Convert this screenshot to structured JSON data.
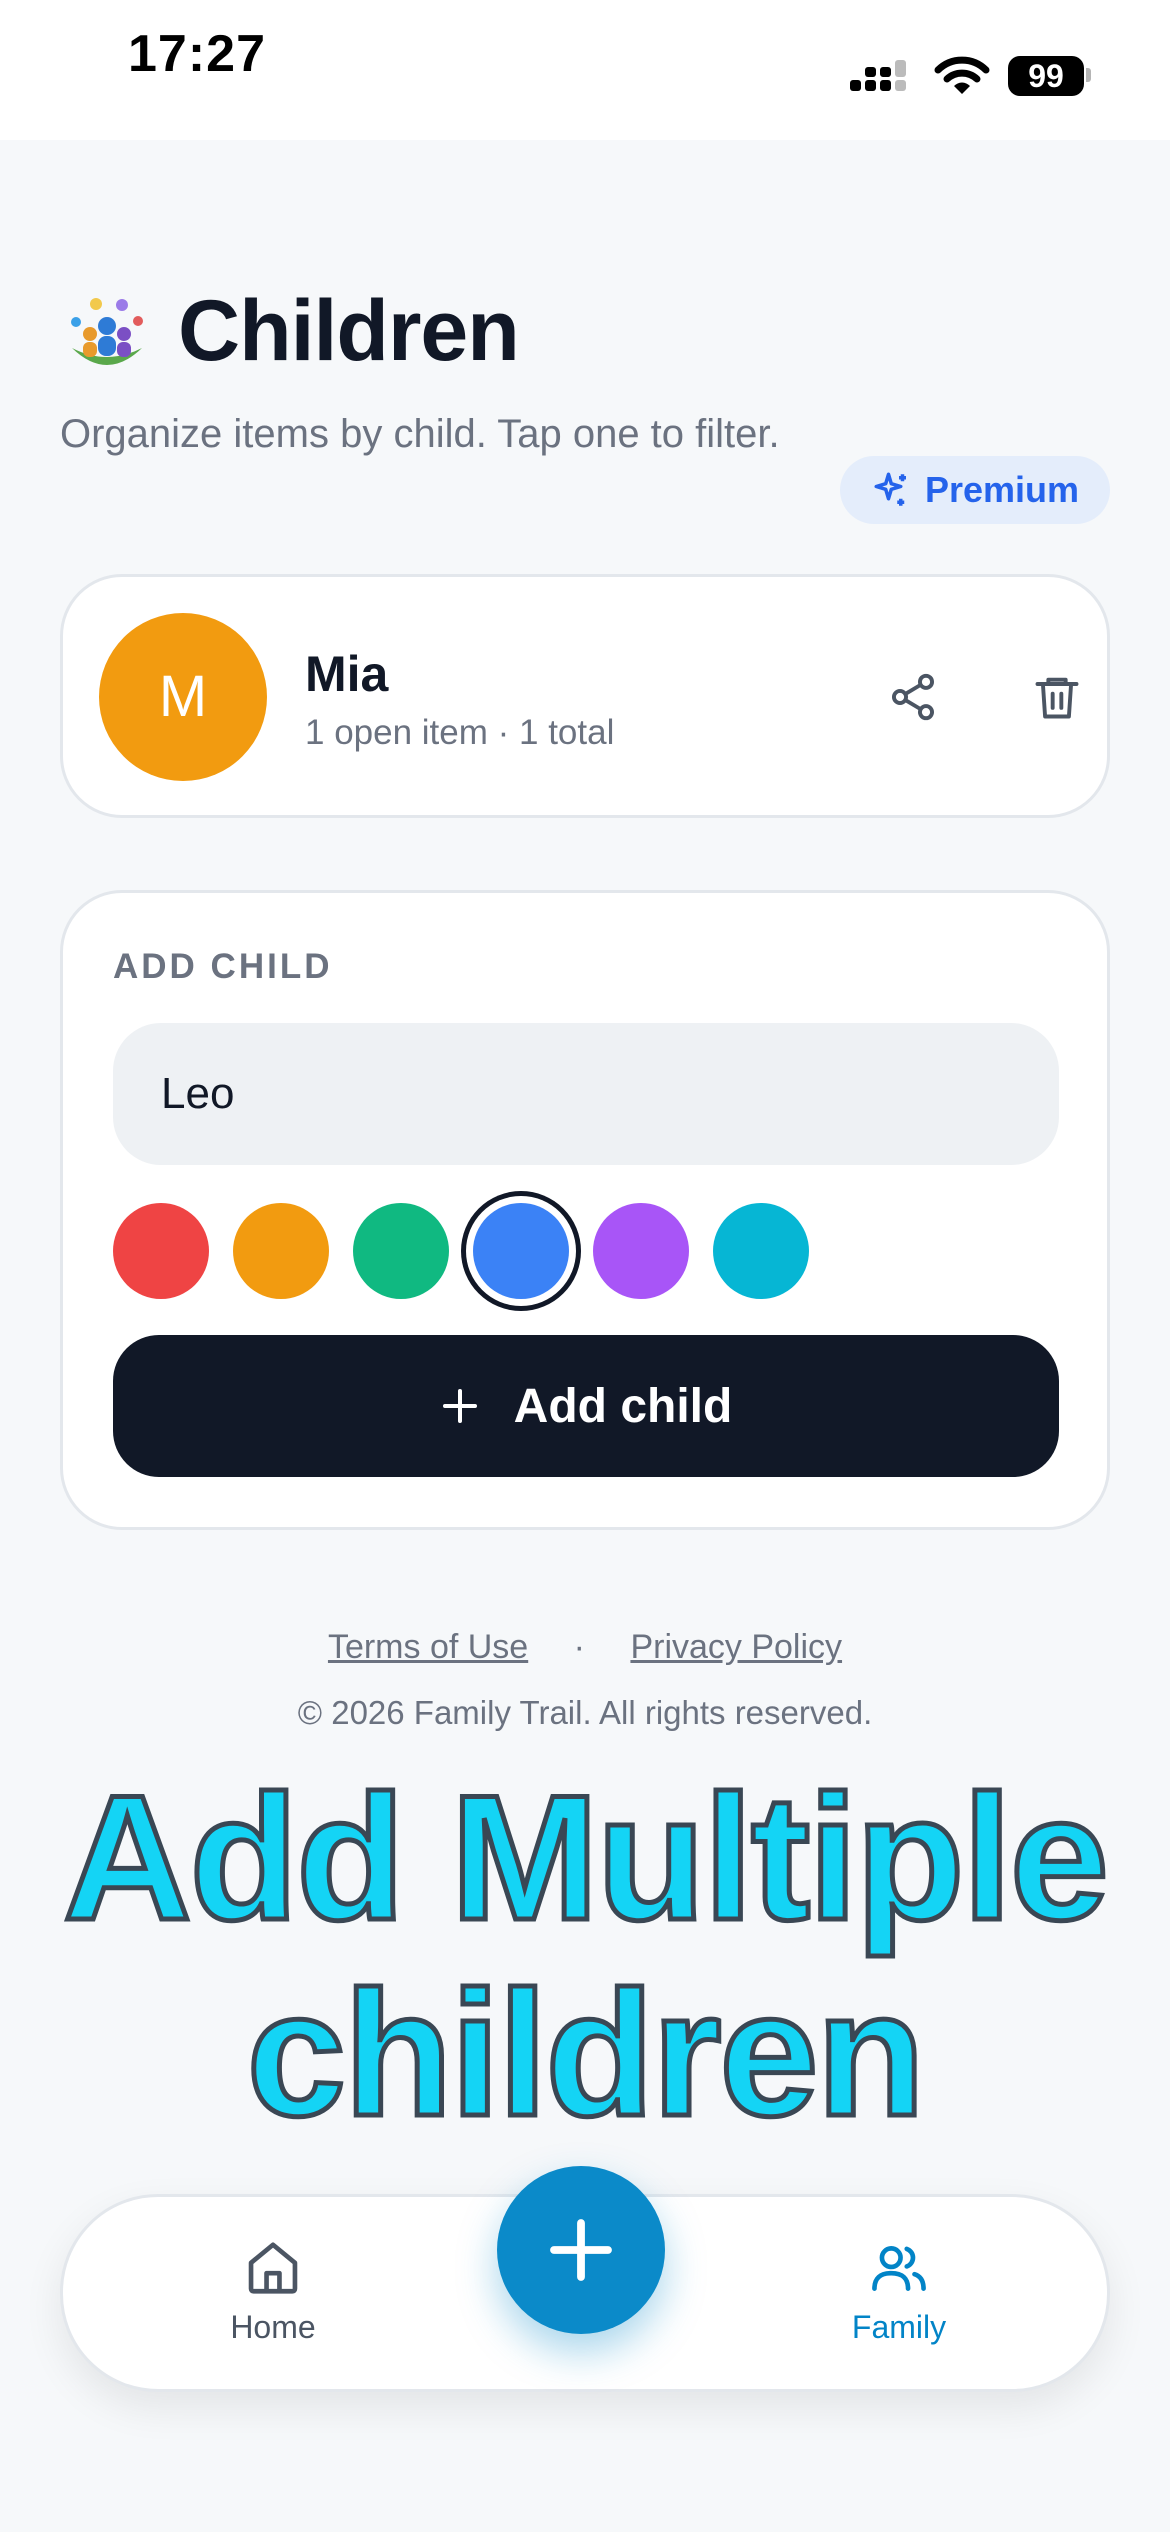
{
  "status_bar": {
    "time": "17:27",
    "battery": "99"
  },
  "header": {
    "title": "Children",
    "subtitle": "Organize items by child. Tap one to filter.",
    "premium_label": "Premium"
  },
  "children": [
    {
      "initial": "M",
      "name": "Mia",
      "meta": "1 open item · 1 total",
      "color": "#f29b10"
    }
  ],
  "add_child": {
    "section_label": "ADD CHILD",
    "name_value": "Leo",
    "colors": [
      "#ef4444",
      "#f29b10",
      "#10b981",
      "#3b82f6",
      "#a855f7",
      "#06b6d4"
    ],
    "selected_color": "#3b82f6",
    "button_label": "Add child"
  },
  "footer": {
    "terms": "Terms of Use",
    "separator": "·",
    "privacy": "Privacy Policy",
    "copyright": "© 2026 Family Trail. All rights reserved."
  },
  "promo": {
    "line1": "Add Multiple",
    "line2": "children"
  },
  "tabbar": {
    "home_label": "Home",
    "family_label": "Family",
    "active_tab": "Family"
  },
  "icons": {
    "share": "share-icon",
    "trash": "trash-icon",
    "plus": "plus-icon",
    "home": "home-icon",
    "family": "users-icon",
    "sparkle": "sparkles-icon"
  }
}
